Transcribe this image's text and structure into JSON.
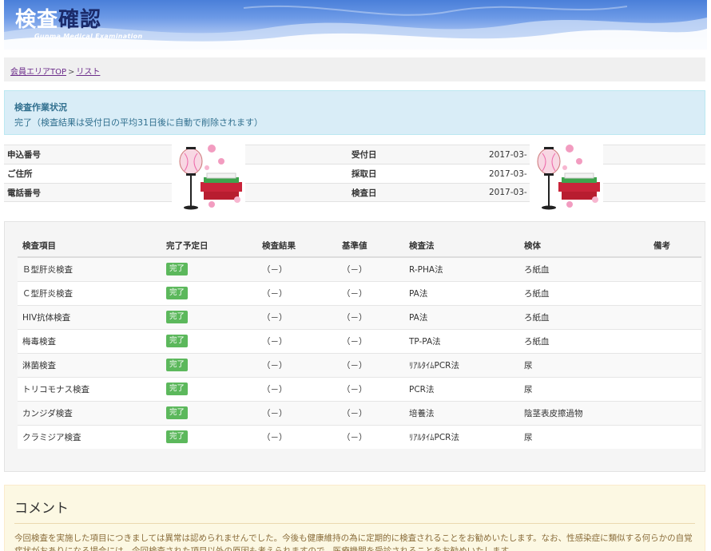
{
  "header": {
    "logo_part1": "検査",
    "logo_part2": "確認",
    "subtitle": "Gunma Medical Examination"
  },
  "breadcrumb": {
    "home": "会員エリアTOP",
    "separator": ">",
    "current": "リスト"
  },
  "status": {
    "title": "検査作業状況",
    "text": "完了（検査結果は受付日の平均31日後に自動で削除されます）"
  },
  "info": {
    "rows": [
      {
        "label": "申込番号",
        "label2": "受付日",
        "value2": "2017-03-"
      },
      {
        "label": "ご住所",
        "label2": "採取日",
        "value2": "2017-03-"
      },
      {
        "label": "電話番号",
        "label2": "検査日",
        "value2": "2017-03-"
      }
    ]
  },
  "results": {
    "headers": [
      "検査項目",
      "完了予定日",
      "検査結果",
      "基準値",
      "検査法",
      "検体",
      "備考"
    ],
    "rows": [
      {
        "item": "Ｂ型肝炎検査",
        "status": "完了",
        "result": "（－）",
        "reference": "（－）",
        "method": "R-PHA法",
        "sample": "ろ紙血",
        "note": ""
      },
      {
        "item": "Ｃ型肝炎検査",
        "status": "完了",
        "result": "（－）",
        "reference": "（－）",
        "method": "PA法",
        "sample": "ろ紙血",
        "note": ""
      },
      {
        "item": "HIV抗体検査",
        "status": "完了",
        "result": "（－）",
        "reference": "（－）",
        "method": "PA法",
        "sample": "ろ紙血",
        "note": ""
      },
      {
        "item": "梅毒検査",
        "status": "完了",
        "result": "（－）",
        "reference": "（－）",
        "method": "TP-PA法",
        "sample": "ろ紙血",
        "note": ""
      },
      {
        "item": "淋菌検査",
        "status": "完了",
        "result": "（－）",
        "reference": "（－）",
        "method": "ﾘｱﾙﾀｲﾑPCR法",
        "sample": "尿",
        "note": ""
      },
      {
        "item": "トリコモナス検査",
        "status": "完了",
        "result": "（－）",
        "reference": "（－）",
        "method": "PCR法",
        "sample": "尿",
        "note": ""
      },
      {
        "item": "カンジダ検査",
        "status": "完了",
        "result": "（－）",
        "reference": "（－）",
        "method": "培養法",
        "sample": "陰茎表皮擦過物",
        "note": ""
      },
      {
        "item": "クラミジア検査",
        "status": "完了",
        "result": "（－）",
        "reference": "（－）",
        "method": "ﾘｱﾙﾀｲﾑPCR法",
        "sample": "尿",
        "note": ""
      }
    ]
  },
  "comment": {
    "title": "コメント",
    "text": "今回検査を実施した項目につきましては異常は認められませんでした。今後も健康維持の為に定期的に検査されることをお勧めいたします。なお、性感染症に類似する何らかの自覚症状がおありになる場合には、今回検査された項目以外の原因も考えられますので、医療機関を受診されることをお勧めいたします。"
  },
  "colors": {
    "badge": "#5cb85c",
    "status_bg": "#d9edf7",
    "comment_bg": "#fcf8e3",
    "link": "#6b2b8a"
  }
}
